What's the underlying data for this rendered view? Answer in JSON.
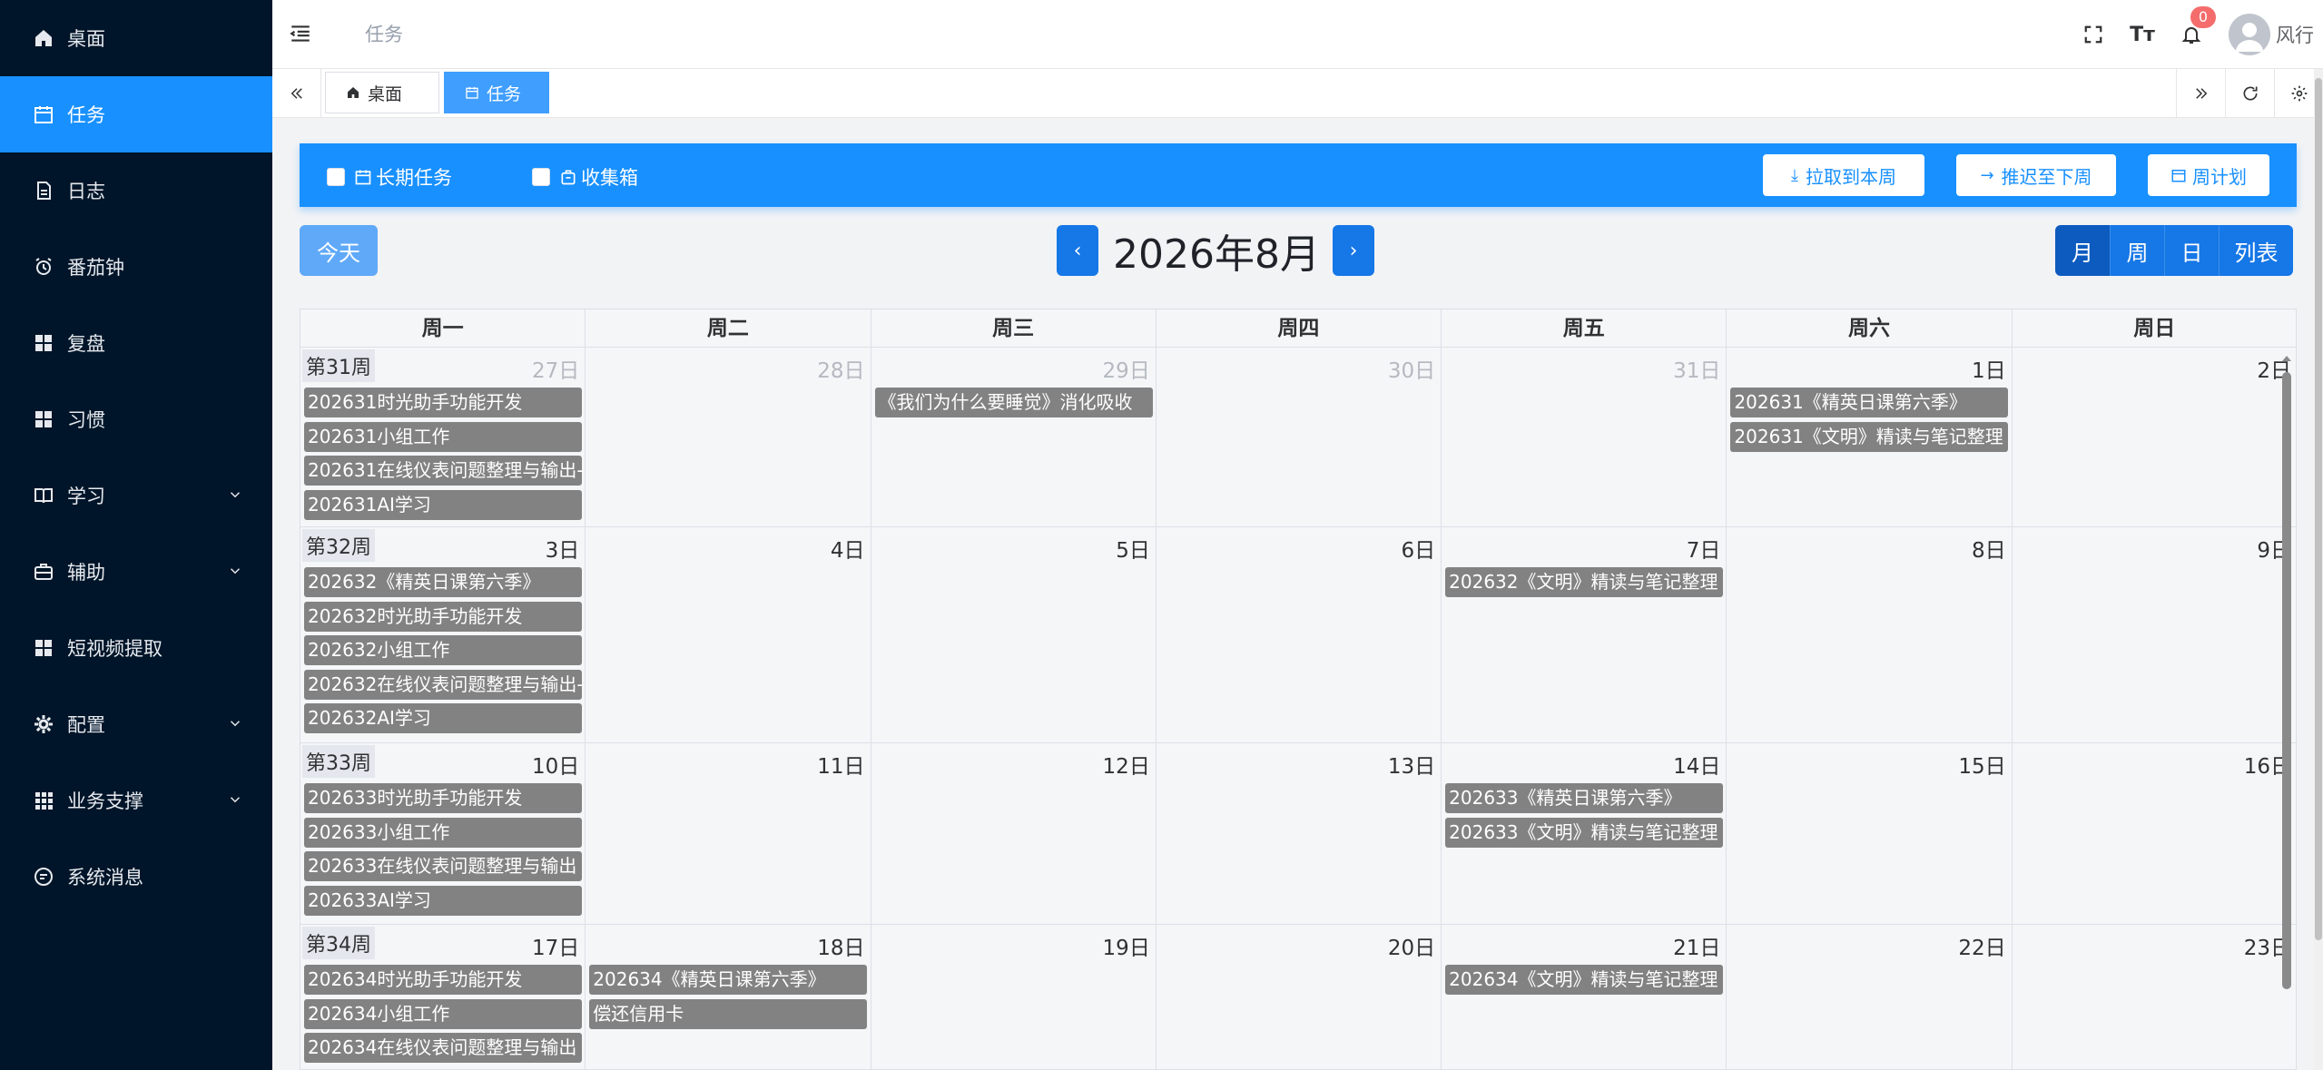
{
  "sidebar": {
    "items": [
      {
        "label": "桌面",
        "icon": "home-icon"
      },
      {
        "label": "任务",
        "icon": "calendar-icon",
        "active": true
      },
      {
        "label": "日志",
        "icon": "document-icon"
      },
      {
        "label": "番茄钟",
        "icon": "alarm-icon"
      },
      {
        "label": "复盘",
        "icon": "grid-icon"
      },
      {
        "label": "习惯",
        "icon": "grid-icon"
      },
      {
        "label": "学习",
        "icon": "book-icon",
        "expandable": true
      },
      {
        "label": "辅助",
        "icon": "briefcase-icon",
        "expandable": true
      },
      {
        "label": "短视频提取",
        "icon": "grid-icon"
      },
      {
        "label": "配置",
        "icon": "gear-icon",
        "expandable": true
      },
      {
        "label": "业务支撑",
        "icon": "apps-icon",
        "expandable": true
      },
      {
        "label": "系统消息",
        "icon": "chat-icon"
      }
    ]
  },
  "header": {
    "breadcrumb": "任务",
    "notification_count": "0",
    "username": "风行",
    "font_size_label": "Tт"
  },
  "tabs": [
    {
      "label": "桌面",
      "icon": "home-icon"
    },
    {
      "label": "任务",
      "icon": "calendar-icon",
      "active": true
    }
  ],
  "toolbar": {
    "long_term_label": "长期任务",
    "inbox_label": "收集箱",
    "pull_label": "拉取到本周",
    "push_label": "推迟至下周",
    "weekly_plan_label": "周计划"
  },
  "calendar": {
    "today_label": "今天",
    "prev_label": "‹",
    "next_label": "›",
    "title": "2026年8月",
    "views": [
      "月",
      "周",
      "日",
      "列表"
    ],
    "active_view": "月",
    "weekdays": [
      "周一",
      "周二",
      "周三",
      "周四",
      "周五",
      "周六",
      "周日"
    ],
    "weeks": [
      {
        "label": "第31周",
        "days": [
          {
            "num": "27日",
            "other": true,
            "events": [
              "202631时光助手功能开发",
              "202631小组工作",
              "202631在线仪表问题整理与输出-",
              "202631AI学习"
            ]
          },
          {
            "num": "28日",
            "other": true,
            "events": []
          },
          {
            "num": "29日",
            "other": true,
            "events": [
              "《我们为什么要睡觉》消化吸收"
            ]
          },
          {
            "num": "30日",
            "other": true,
            "events": []
          },
          {
            "num": "31日",
            "other": true,
            "events": []
          },
          {
            "num": "1日",
            "other": false,
            "events": [
              "202631《精英日课第六季》",
              "202631《文明》精读与笔记整理"
            ]
          },
          {
            "num": "2日",
            "other": false,
            "events": []
          }
        ]
      },
      {
        "label": "第32周",
        "days": [
          {
            "num": "3日",
            "other": false,
            "events": [
              "202632《精英日课第六季》",
              "202632时光助手功能开发",
              "202632小组工作",
              "202632在线仪表问题整理与输出-",
              "202632AI学习"
            ]
          },
          {
            "num": "4日",
            "other": false,
            "events": []
          },
          {
            "num": "5日",
            "other": false,
            "events": []
          },
          {
            "num": "6日",
            "other": false,
            "events": []
          },
          {
            "num": "7日",
            "other": false,
            "events": [
              "202632《文明》精读与笔记整理"
            ]
          },
          {
            "num": "8日",
            "other": false,
            "events": []
          },
          {
            "num": "9日",
            "other": false,
            "events": []
          }
        ]
      },
      {
        "label": "第33周",
        "days": [
          {
            "num": "10日",
            "other": false,
            "events": [
              "202633时光助手功能开发",
              "202633小组工作",
              "202633在线仪表问题整理与输出",
              "202633AI学习"
            ]
          },
          {
            "num": "11日",
            "other": false,
            "events": []
          },
          {
            "num": "12日",
            "other": false,
            "events": []
          },
          {
            "num": "13日",
            "other": false,
            "events": []
          },
          {
            "num": "14日",
            "other": false,
            "events": [
              "202633《精英日课第六季》",
              "202633《文明》精读与笔记整理"
            ]
          },
          {
            "num": "15日",
            "other": false,
            "events": []
          },
          {
            "num": "16日",
            "other": false,
            "events": []
          }
        ]
      },
      {
        "label": "第34周",
        "days": [
          {
            "num": "17日",
            "other": false,
            "events": [
              "202634时光助手功能开发",
              "202634小组工作",
              "202634在线仪表问题整理与输出"
            ]
          },
          {
            "num": "18日",
            "other": false,
            "events": [
              "202634《精英日课第六季》",
              "偿还信用卡"
            ]
          },
          {
            "num": "19日",
            "other": false,
            "events": []
          },
          {
            "num": "20日",
            "other": false,
            "events": []
          },
          {
            "num": "21日",
            "other": false,
            "events": [
              "202634《文明》精读与笔记整理"
            ]
          },
          {
            "num": "22日",
            "other": false,
            "events": []
          },
          {
            "num": "23日",
            "other": false,
            "events": []
          }
        ]
      }
    ]
  },
  "colors": {
    "sidebar_bg": "#001529",
    "accent": "#1890ff",
    "event_bg": "#828282",
    "badge": "#f56c6c"
  }
}
